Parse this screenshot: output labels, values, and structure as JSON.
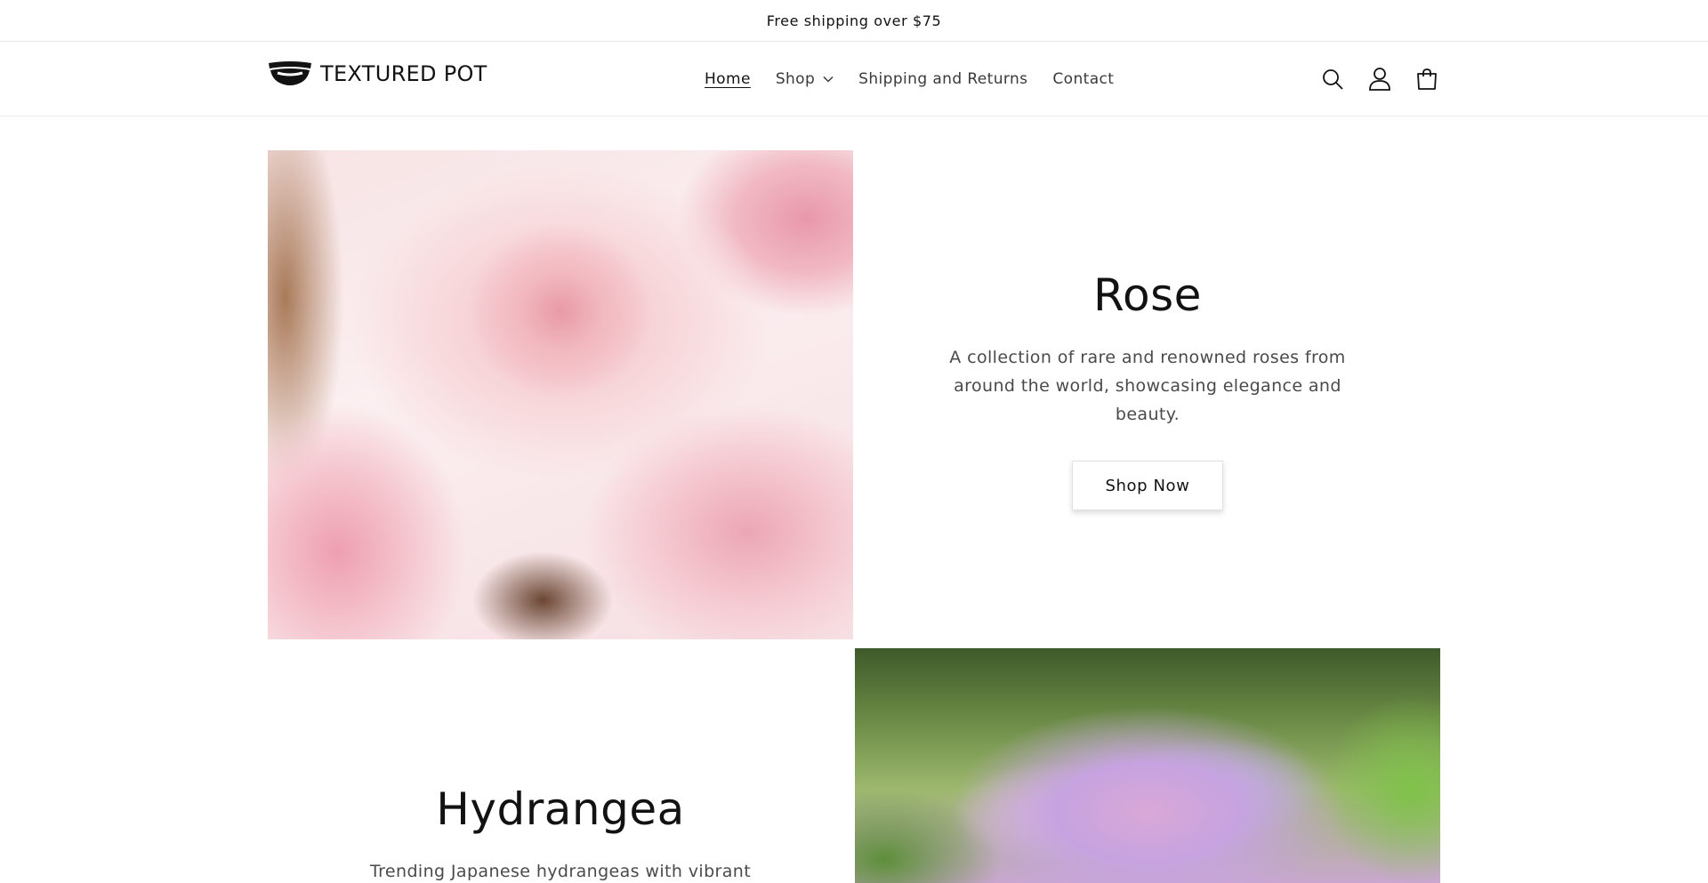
{
  "announcement": {
    "text": "Free shipping over $75"
  },
  "header": {
    "logo_text": "TEXTURED POT",
    "nav": [
      {
        "label": "Home",
        "active": true
      },
      {
        "label": "Shop",
        "has_dropdown": true
      },
      {
        "label": "Shipping and Returns"
      },
      {
        "label": "Contact"
      }
    ],
    "icons": [
      "search-icon",
      "account-icon",
      "cart-icon"
    ]
  },
  "collections": [
    {
      "title": "Rose",
      "description": "A collection of rare and renowned roses from around the world, showcasing elegance and beauty.",
      "button_label": "Shop Now"
    },
    {
      "title": "Hydrangea",
      "description": "Trending Japanese hydrangeas with vibrant"
    }
  ],
  "colors": {
    "text": "#121212",
    "muted": "#4a4a4a",
    "border": "#e6e6e6",
    "background": "#ffffff"
  }
}
